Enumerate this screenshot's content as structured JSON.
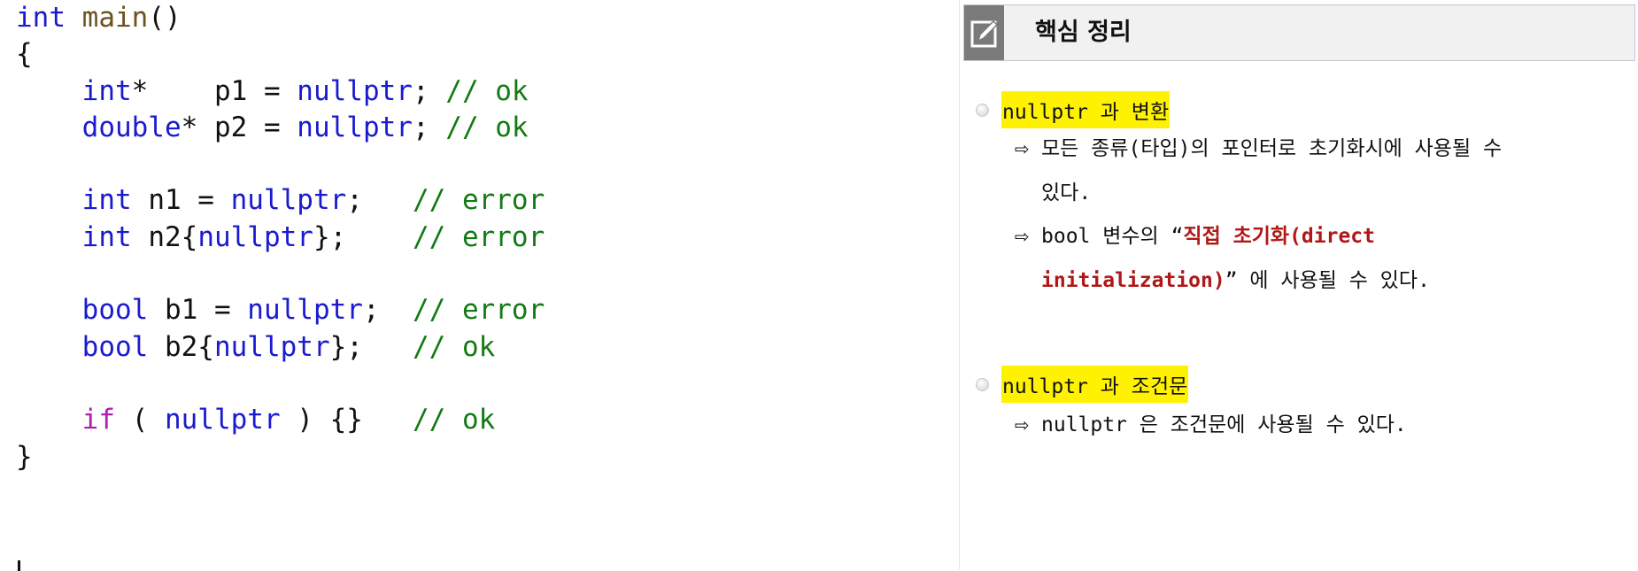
{
  "code": {
    "lines": [
      [
        [
          "int",
          "kw"
        ],
        [
          " ",
          "pl"
        ],
        [
          "main",
          "fn"
        ],
        [
          "()",
          "pl"
        ]
      ],
      [
        [
          "{",
          "pl"
        ]
      ],
      [
        [
          "    ",
          "pl"
        ],
        [
          "int",
          "kw"
        ],
        [
          "*    p1 = ",
          "pl"
        ],
        [
          "nullptr",
          "kw"
        ],
        [
          "; ",
          "pl"
        ],
        [
          "// ok",
          "cm"
        ]
      ],
      [
        [
          "    ",
          "pl"
        ],
        [
          "double",
          "kw"
        ],
        [
          "* p2 = ",
          "pl"
        ],
        [
          "nullptr",
          "kw"
        ],
        [
          "; ",
          "pl"
        ],
        [
          "// ok",
          "cm"
        ]
      ],
      [],
      [
        [
          "    ",
          "pl"
        ],
        [
          "int",
          "kw"
        ],
        [
          " n1 = ",
          "pl"
        ],
        [
          "nullptr",
          "kw"
        ],
        [
          ";   ",
          "pl"
        ],
        [
          "// error",
          "cm"
        ]
      ],
      [
        [
          "    ",
          "pl"
        ],
        [
          "int",
          "kw"
        ],
        [
          " n2{",
          "pl"
        ],
        [
          "nullptr",
          "kw"
        ],
        [
          "};    ",
          "pl"
        ],
        [
          "// error",
          "cm"
        ]
      ],
      [],
      [
        [
          "    ",
          "pl"
        ],
        [
          "bool",
          "kw"
        ],
        [
          " b1 = ",
          "pl"
        ],
        [
          "nullptr",
          "kw"
        ],
        [
          ";  ",
          "pl"
        ],
        [
          "// error",
          "cm"
        ]
      ],
      [
        [
          "    ",
          "pl"
        ],
        [
          "bool",
          "kw"
        ],
        [
          " b2{",
          "pl"
        ],
        [
          "nullptr",
          "kw"
        ],
        [
          "};   ",
          "pl"
        ],
        [
          "// ok",
          "cm"
        ]
      ],
      [],
      [
        [
          "    ",
          "pl"
        ],
        [
          "if",
          "ctl"
        ],
        [
          " ( ",
          "pl"
        ],
        [
          "nullptr",
          "kw"
        ],
        [
          " ) {}   ",
          "pl"
        ],
        [
          "// ok",
          "cm"
        ]
      ],
      [
        [
          "}",
          "pl"
        ]
      ]
    ]
  },
  "summary": {
    "icon": "edit-pencil-icon",
    "title": "핵심 정리",
    "sections": [
      {
        "heading": "nullptr 과 변환",
        "items": [
          {
            "line1": "모든 종류(타입)의 포인터로 초기화시에 사용될 수",
            "line2": "있다."
          },
          {
            "pre": "bool 변수의 “",
            "red1": "직접 초기화(direct",
            "red2": "initialization)",
            "post": "” 에 사용될 수 있다."
          }
        ]
      },
      {
        "heading": "nullptr 과 조건문",
        "items": [
          {
            "line1": "nullptr 은 조건문에 사용될 수 있다."
          }
        ]
      }
    ],
    "arrow": "⇨",
    "colors": {
      "highlight": "#fff200",
      "emphasis": "#b01818",
      "keyword": "#1a1ad0",
      "comment": "#137a13"
    }
  }
}
